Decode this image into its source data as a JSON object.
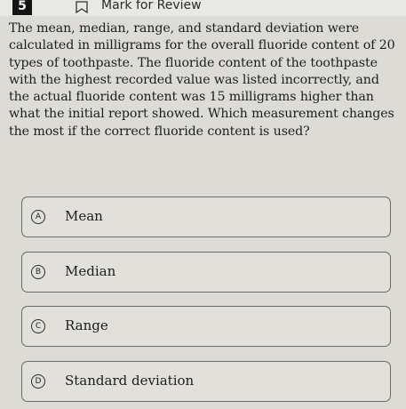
{
  "header": {
    "question_number": "5",
    "mark_for_review_label": "Mark for Review"
  },
  "question": {
    "stem": "The mean, median, range, and standard deviation were calculated in milligrams for the overall fluoride content of 20 types of toothpaste. The fluoride content of the toothpaste with the highest recorded value was listed incorrectly, and the actual fluoride content was 15 milligrams higher than what the initial report showed. Which measurement changes the most if the correct fluoride content is used?"
  },
  "options": [
    {
      "letter": "A",
      "text": "Mean"
    },
    {
      "letter": "B",
      "text": "Median"
    },
    {
      "letter": "C",
      "text": "Range"
    },
    {
      "letter": "D",
      "text": "Standard deviation"
    }
  ]
}
